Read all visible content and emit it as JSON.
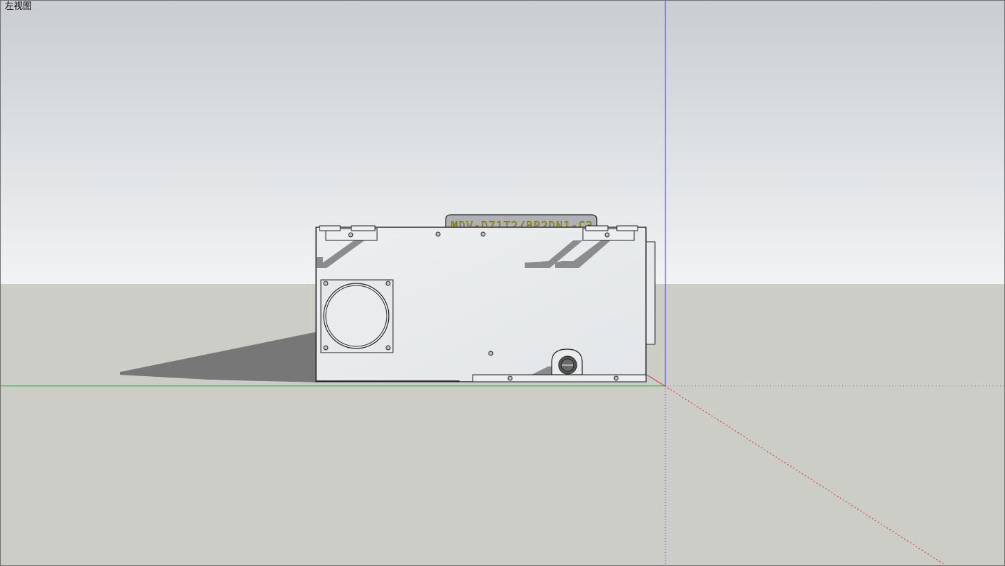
{
  "viewport": {
    "view_name": "左视图",
    "colors": {
      "sky_top": "#c9cdd1",
      "sky_bottom": "#f1f3f4",
      "ground": "#cccdc7",
      "axis_blue": "#3333ff",
      "axis_green": "#22bb22",
      "axis_red": "#dd2222",
      "shadow": "#777777",
      "model_face": "#e9ebec",
      "label_text": "#c8b400"
    }
  },
  "model": {
    "nameplate_text": "MDV-D71T2/BP2DN1-C3",
    "icons": [
      "round-duct-port-icon",
      "drain-outlet-icon"
    ]
  }
}
